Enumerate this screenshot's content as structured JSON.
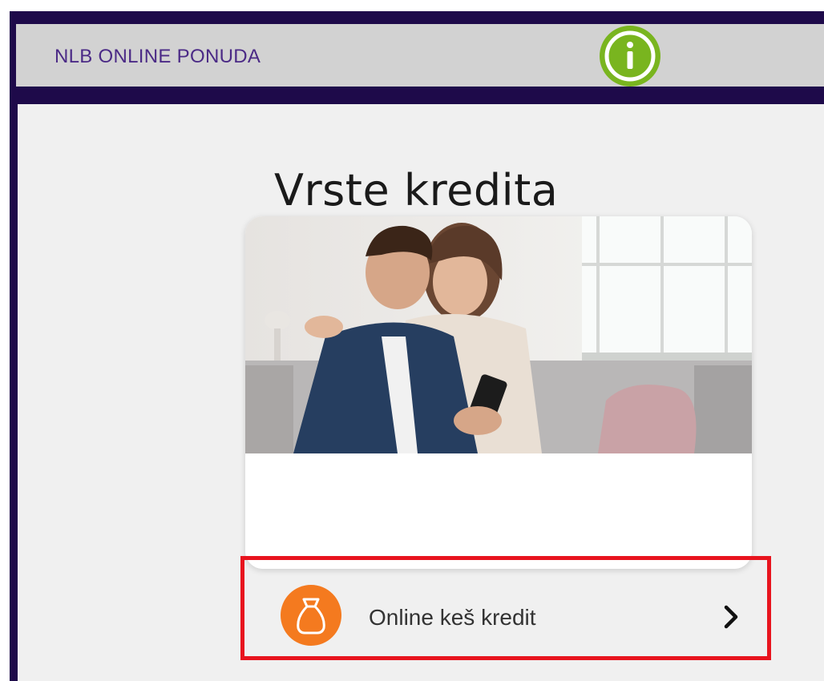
{
  "header": {
    "title": "NLB ONLINE PONUDA",
    "info_icon": "info-icon",
    "info_color": "#79b51f"
  },
  "main": {
    "page_title": "Vrste kredita",
    "cards": [
      {
        "label": "Online keš kredit",
        "icon": "money-bag-icon",
        "icon_color": "#f47a1f",
        "chevron": "chevron-right-icon"
      }
    ]
  },
  "colors": {
    "brand_purple": "#4b2a86",
    "frame_dark": "#1e0a4a",
    "highlight_red": "#e8141e"
  }
}
